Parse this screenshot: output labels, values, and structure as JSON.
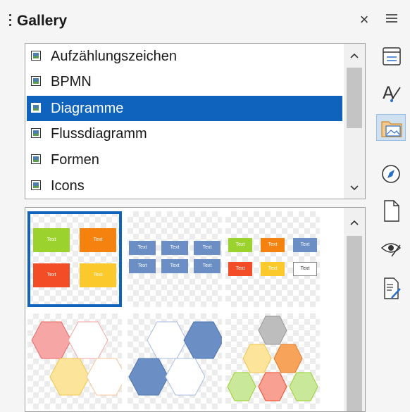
{
  "panel": {
    "title": "Gallery",
    "close_glyph": "×",
    "menu_glyph": "≡"
  },
  "categories": [
    {
      "label": "Aufzählungszeichen",
      "selected": false
    },
    {
      "label": "BPMN",
      "selected": false
    },
    {
      "label": "Diagramme",
      "selected": true
    },
    {
      "label": "Flussdiagramm",
      "selected": false
    },
    {
      "label": "Formen",
      "selected": false
    },
    {
      "label": "Icons",
      "selected": false
    }
  ],
  "scroll": {
    "up_glyph": "⌃",
    "down_glyph": "⌄"
  },
  "thumbnails": {
    "box_text": "Text",
    "items": [
      {
        "name": "diagram-4-boxes-color",
        "selected": true
      },
      {
        "name": "diagram-6-boxes-blue",
        "selected": false
      },
      {
        "name": "diagram-8-boxes-color",
        "selected": false
      },
      {
        "name": "diagram-hex-4-color",
        "selected": false
      },
      {
        "name": "diagram-hex-4-blue",
        "selected": false
      },
      {
        "name": "diagram-hex-6-color",
        "selected": false
      }
    ]
  },
  "sidebar": {
    "tabs": [
      {
        "name": "properties-icon",
        "active": false
      },
      {
        "name": "styles-icon",
        "active": false
      },
      {
        "name": "gallery-icon",
        "active": true
      },
      {
        "name": "navigator-icon",
        "active": false
      },
      {
        "name": "page-icon",
        "active": false
      },
      {
        "name": "style-inspector-icon",
        "active": false
      },
      {
        "name": "manage-changes-icon",
        "active": false
      }
    ]
  },
  "colors": {
    "accent": "#0f63bd",
    "green": "#9bd22e",
    "orange": "#f5810f",
    "red": "#f24d27",
    "yellow": "#fcc92c",
    "blue": "#6b8fc4"
  }
}
